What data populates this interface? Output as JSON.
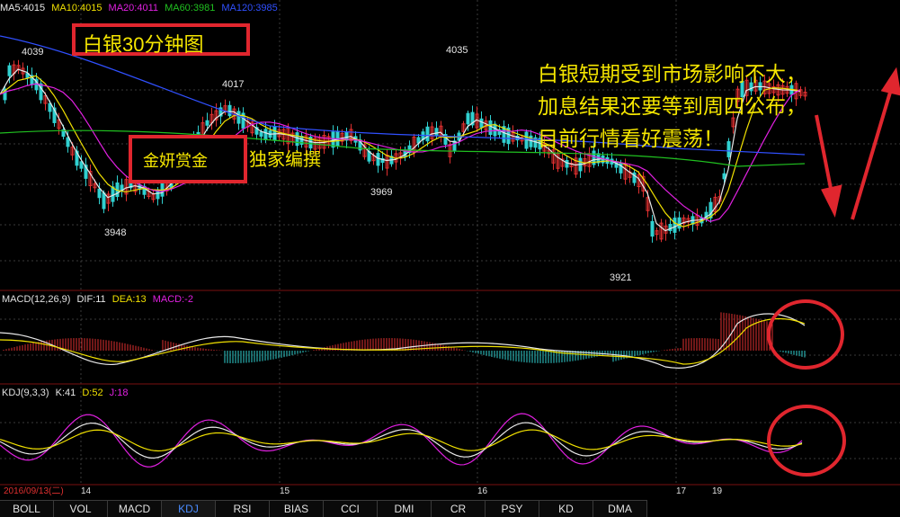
{
  "main_indicators": {
    "ma5": "MA5:4015",
    "ma10": "MA10:4015",
    "ma20": "MA20:4011",
    "ma60": "MA60:3981",
    "ma120": "MA120:3985"
  },
  "colors": {
    "ma5": "#e8e8e8",
    "ma10": "#f0e000",
    "ma20": "#e020e0",
    "ma60": "#20c020",
    "ma120": "#3050ff",
    "up": "#e03030",
    "down": "#30d0d0",
    "title_border": "#e0262e",
    "annotation": "#f5e600"
  },
  "title": "白银30分钟图",
  "brand": {
    "name": "金妍赏金",
    "subtitle": "独家编撰"
  },
  "annotation_lines": [
    "白银短期受到市场影响不大，",
    "加息结果还要等到周四公布，",
    "目前行情看好震荡！"
  ],
  "price_labels": {
    "p4039": "4039",
    "p4035": "4035",
    "p4017": "4017",
    "p3969": "3969",
    "p3948": "3948",
    "p3921": "3921"
  },
  "macd_panel": {
    "label": "MACD(12,26,9)",
    "dif": "DIF:11",
    "dea": "DEA:13",
    "macd": "MACD:-2"
  },
  "kdj_panel": {
    "label": "KDJ(9,3,3)",
    "k": "K:41",
    "d": "D:52",
    "j": "J:18"
  },
  "dates": {
    "start": "2016/09/13(二)",
    "d14": "14",
    "d15": "15",
    "d16": "16",
    "d17": "17",
    "d19": "19"
  },
  "tabs": [
    "BOLL",
    "VOL",
    "MACD",
    "KDJ",
    "RSI",
    "BIAS",
    "CCI",
    "DMI",
    "CR",
    "PSY",
    "KD",
    "DMA"
  ],
  "active_tab": "KDJ"
}
